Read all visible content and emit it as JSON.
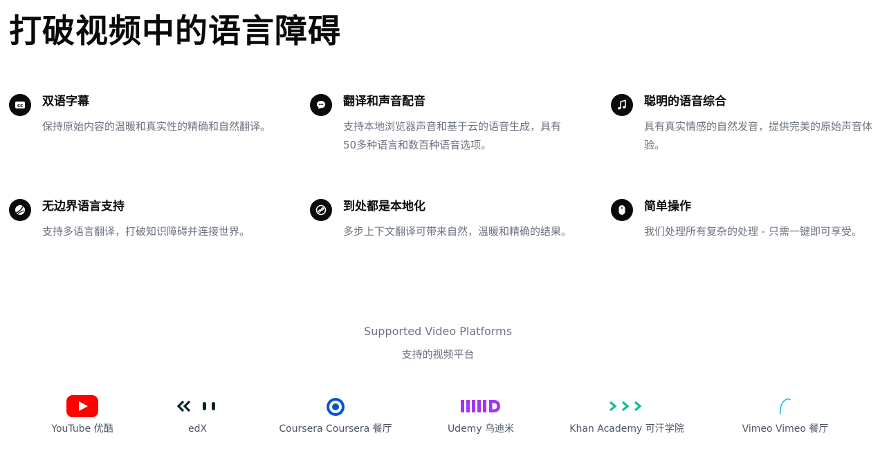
{
  "hero": {
    "title": "打破视频中的语言障碍"
  },
  "features": [
    {
      "title": "双语字幕",
      "desc": "保持原始内容的温暖和真实性的精确和自然翻译。",
      "icon": "cc-icon"
    },
    {
      "title": "翻译和声音配音",
      "desc": "支持本地浏览器声音和基于云的语音生成，具有50多种语言和数百种语音选项。",
      "icon": "chat-bubble-icon"
    },
    {
      "title": "聪明的语音综合",
      "desc": "具有真实情感的自然发音，提供完美的原始声音体验。",
      "icon": "music-note-icon"
    },
    {
      "title": "无边界语言支持",
      "desc": "支持多语言翻译，打破知识障碍并连接世界。",
      "icon": "globe-icon"
    },
    {
      "title": "到处都是本地化",
      "desc": "多步上下文翻译可带来自然，温暖和精确的结果。",
      "icon": "link-icon"
    },
    {
      "title": "简单操作",
      "desc": "我们处理所有复杂的处理 - 只需一键即可享受。",
      "icon": "mouse-icon"
    }
  ],
  "platforms": {
    "heading_en": "Supported Video Platforms",
    "heading_zh": "支持的视频平台",
    "items": [
      {
        "label": "YouTube  优酷",
        "icon": "youtube-logo-icon",
        "color": "#ff0000"
      },
      {
        "label": "edX",
        "icon": "edx-logo-icon",
        "color": "#02262b"
      },
      {
        "label": "Coursera  Coursera 餐厅",
        "icon": "coursera-logo-icon",
        "color": "#0056d2"
      },
      {
        "label": "Udemy  乌迪米",
        "icon": "udemy-logo-icon",
        "color": "#a435f0"
      },
      {
        "label": "Khan Academy  可汗学院",
        "icon": "khan-academy-logo-icon",
        "color": "#14bf96"
      },
      {
        "label": "Vimeo  Vimeo 餐厅",
        "icon": "vimeo-logo-icon",
        "color": "#1ab7ea"
      }
    ]
  }
}
